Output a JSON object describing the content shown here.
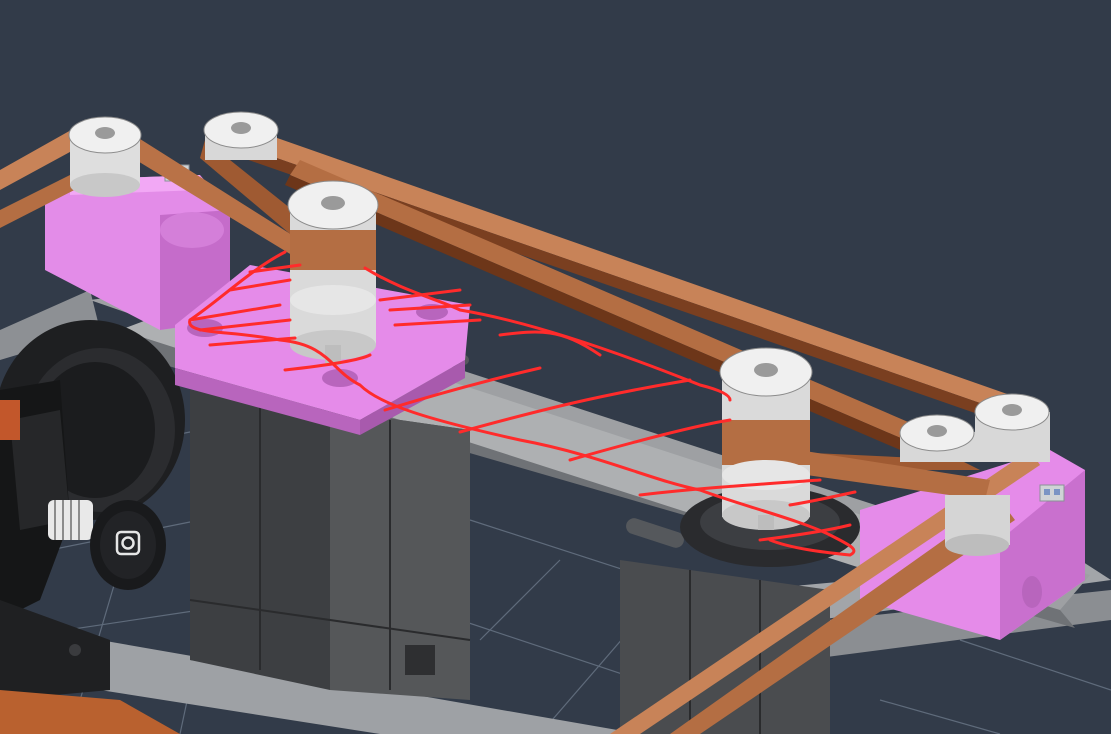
{
  "viewport": {
    "background": "#323b49",
    "grid_color": "#5f6b7b",
    "scene": "cad-3d-model"
  },
  "colors": {
    "belt_top": "#c07a50",
    "belt_side": "#8a4b2a",
    "printed_part": "#e58be9",
    "printed_part_dark": "#b865bd",
    "plate": "#8f9194",
    "plate_light": "#b9bbbd",
    "motor": "#4d4f52",
    "motor_dark": "#2f3033",
    "pulley": "#e4e4e4",
    "annotation": "#ff2b2b"
  },
  "icons": {
    "joint_marker_left": "joint-marker-icon",
    "joint_marker_right": "joint-marker-icon"
  }
}
